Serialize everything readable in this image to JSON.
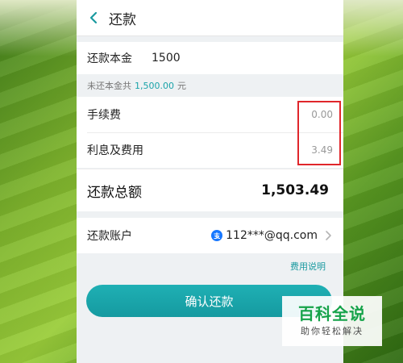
{
  "header": {
    "title": "还款"
  },
  "principal": {
    "label": "还款本金",
    "value": "1500"
  },
  "outstanding": {
    "prefix": "未还本金共",
    "amount": "1,500.00",
    "unit": "元"
  },
  "fees": [
    {
      "label": "手续费",
      "value": "0.00"
    },
    {
      "label": "利息及费用",
      "value": "3.49"
    }
  ],
  "total": {
    "label": "还款总额",
    "value": "1,503.49"
  },
  "account": {
    "label": "还款账户",
    "value": "112***@qq.com"
  },
  "fee_info_link": "费用说明",
  "confirm_button": "确认还款",
  "watermark": {
    "title": "百科全说",
    "subtitle": "助你轻松解决"
  },
  "colors": {
    "accent": "#1aa3a9",
    "highlight_box": "#e0262b",
    "watermark": "#16a34a"
  },
  "icons": {
    "back": "chevron-left-icon",
    "account_logo": "alipay-icon",
    "account_arrow": "chevron-right-icon"
  }
}
